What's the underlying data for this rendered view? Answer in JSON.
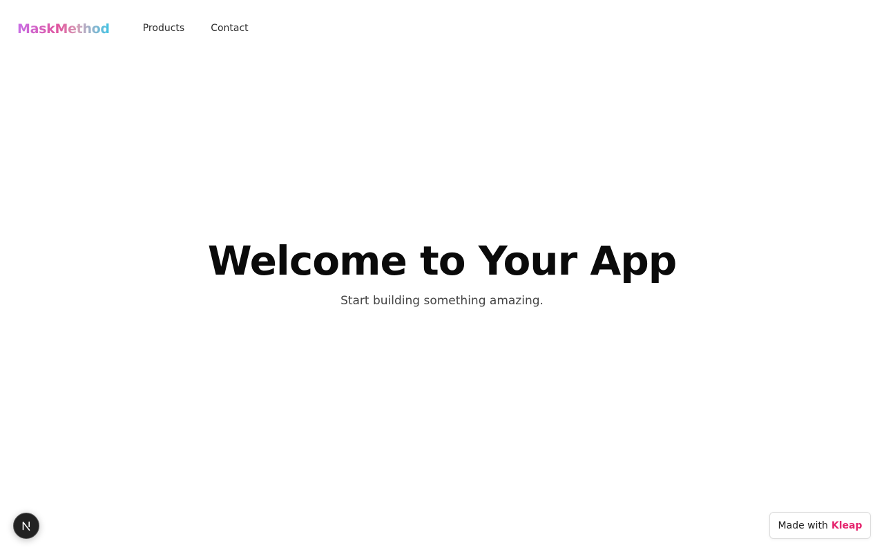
{
  "header": {
    "logo": "MaskMethod",
    "nav": [
      {
        "label": "Products"
      },
      {
        "label": "Contact"
      }
    ]
  },
  "hero": {
    "title": "Welcome to Your App",
    "subtitle": "Start building something amazing."
  },
  "dev_badge": {
    "icon": "nextjs-icon",
    "letter": "N"
  },
  "made_with": {
    "prefix": "Made with",
    "brand": "Kleap",
    "brand_color": "#e5256e"
  },
  "colors": {
    "logo_gradient": [
      "#c86ee6",
      "#e0559e",
      "#9fb0c8",
      "#3ec3e4"
    ],
    "background": "#ffffff",
    "text": "#0a0a0a"
  }
}
